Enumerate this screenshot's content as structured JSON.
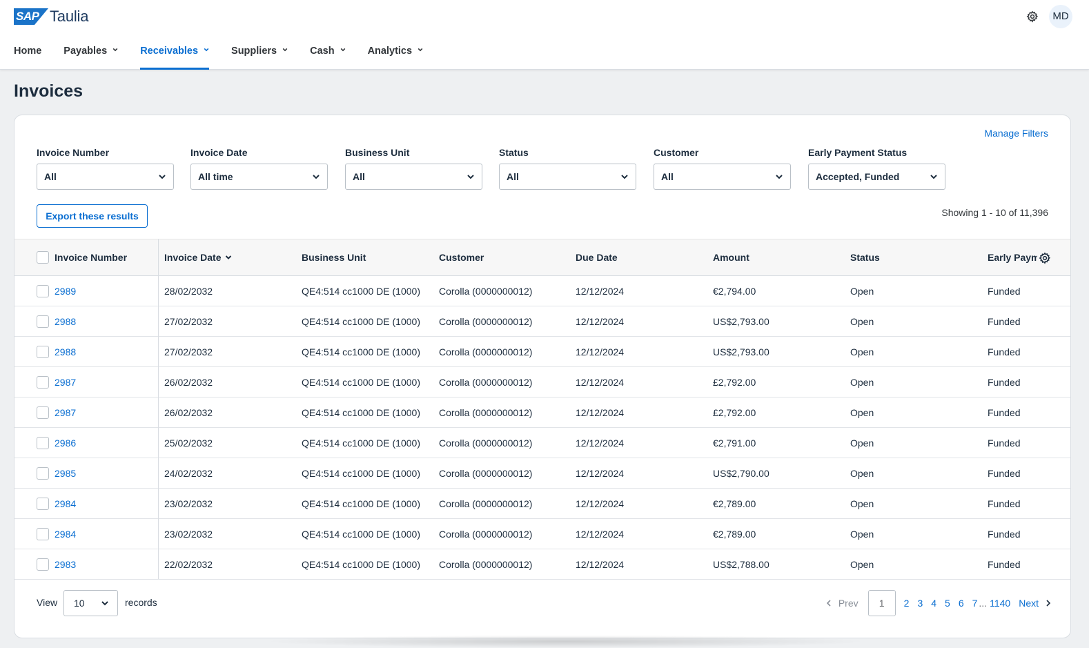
{
  "header": {
    "sap_logo_text": "SAP",
    "brand": "Taulia",
    "avatar_initials": "MD",
    "accent_color": "#0a6ed1",
    "nav": [
      {
        "label": "Home",
        "has_dropdown": false,
        "active": false
      },
      {
        "label": "Payables",
        "has_dropdown": true,
        "active": false
      },
      {
        "label": "Receivables",
        "has_dropdown": true,
        "active": true
      },
      {
        "label": "Suppliers",
        "has_dropdown": true,
        "active": false
      },
      {
        "label": "Cash",
        "has_dropdown": true,
        "active": false
      },
      {
        "label": "Analytics",
        "has_dropdown": true,
        "active": false
      }
    ]
  },
  "page": {
    "title": "Invoices",
    "manage_filters": "Manage Filters",
    "export_label": "Export these results",
    "showing": "Showing 1 - 10 of 11,396"
  },
  "filters": [
    {
      "label": "Invoice Number",
      "value": "All"
    },
    {
      "label": "Invoice Date",
      "value": "All time"
    },
    {
      "label": "Business Unit",
      "value": "All"
    },
    {
      "label": "Status",
      "value": "All"
    },
    {
      "label": "Customer",
      "value": "All"
    },
    {
      "label": "Early Payment Status",
      "value": "Accepted, Funded"
    }
  ],
  "table": {
    "columns": [
      "Invoice Number",
      "Invoice Date",
      "Business Unit",
      "Customer",
      "Due Date",
      "Amount",
      "Status",
      "Early Paym"
    ],
    "rows": [
      {
        "invoice": "2989",
        "date": "28/02/2032",
        "bu": "QE4:514 cc1000 DE (1000)",
        "customer": "Corolla (0000000012)",
        "due": "12/12/2024",
        "amount": "€2,794.00",
        "status": "Open",
        "early": "Funded"
      },
      {
        "invoice": "2988",
        "date": "27/02/2032",
        "bu": "QE4:514 cc1000 DE (1000)",
        "customer": "Corolla (0000000012)",
        "due": "12/12/2024",
        "amount": "US$2,793.00",
        "status": "Open",
        "early": "Funded"
      },
      {
        "invoice": "2988",
        "date": "27/02/2032",
        "bu": "QE4:514 cc1000 DE (1000)",
        "customer": "Corolla (0000000012)",
        "due": "12/12/2024",
        "amount": "US$2,793.00",
        "status": "Open",
        "early": "Funded"
      },
      {
        "invoice": "2987",
        "date": "26/02/2032",
        "bu": "QE4:514 cc1000 DE (1000)",
        "customer": "Corolla (0000000012)",
        "due": "12/12/2024",
        "amount": "£2,792.00",
        "status": "Open",
        "early": "Funded"
      },
      {
        "invoice": "2987",
        "date": "26/02/2032",
        "bu": "QE4:514 cc1000 DE (1000)",
        "customer": "Corolla (0000000012)",
        "due": "12/12/2024",
        "amount": "£2,792.00",
        "status": "Open",
        "early": "Funded"
      },
      {
        "invoice": "2986",
        "date": "25/02/2032",
        "bu": "QE4:514 cc1000 DE (1000)",
        "customer": "Corolla (0000000012)",
        "due": "12/12/2024",
        "amount": "€2,791.00",
        "status": "Open",
        "early": "Funded"
      },
      {
        "invoice": "2985",
        "date": "24/02/2032",
        "bu": "QE4:514 cc1000 DE (1000)",
        "customer": "Corolla (0000000012)",
        "due": "12/12/2024",
        "amount": "US$2,790.00",
        "status": "Open",
        "early": "Funded"
      },
      {
        "invoice": "2984",
        "date": "23/02/2032",
        "bu": "QE4:514 cc1000 DE (1000)",
        "customer": "Corolla (0000000012)",
        "due": "12/12/2024",
        "amount": "€2,789.00",
        "status": "Open",
        "early": "Funded"
      },
      {
        "invoice": "2984",
        "date": "23/02/2032",
        "bu": "QE4:514 cc1000 DE (1000)",
        "customer": "Corolla (0000000012)",
        "due": "12/12/2024",
        "amount": "€2,789.00",
        "status": "Open",
        "early": "Funded"
      },
      {
        "invoice": "2983",
        "date": "22/02/2032",
        "bu": "QE4:514 cc1000 DE (1000)",
        "customer": "Corolla (0000000012)",
        "due": "12/12/2024",
        "amount": "US$2,788.00",
        "status": "Open",
        "early": "Funded"
      }
    ]
  },
  "footer": {
    "view_label": "View",
    "page_size": "10",
    "records_label": "records",
    "prev_label": "Prev",
    "current_page": "1",
    "pages": [
      "2",
      "3",
      "4",
      "5",
      "6",
      "7"
    ],
    "ellipsis": "...",
    "last_page": "1140",
    "next_label": "Next"
  }
}
